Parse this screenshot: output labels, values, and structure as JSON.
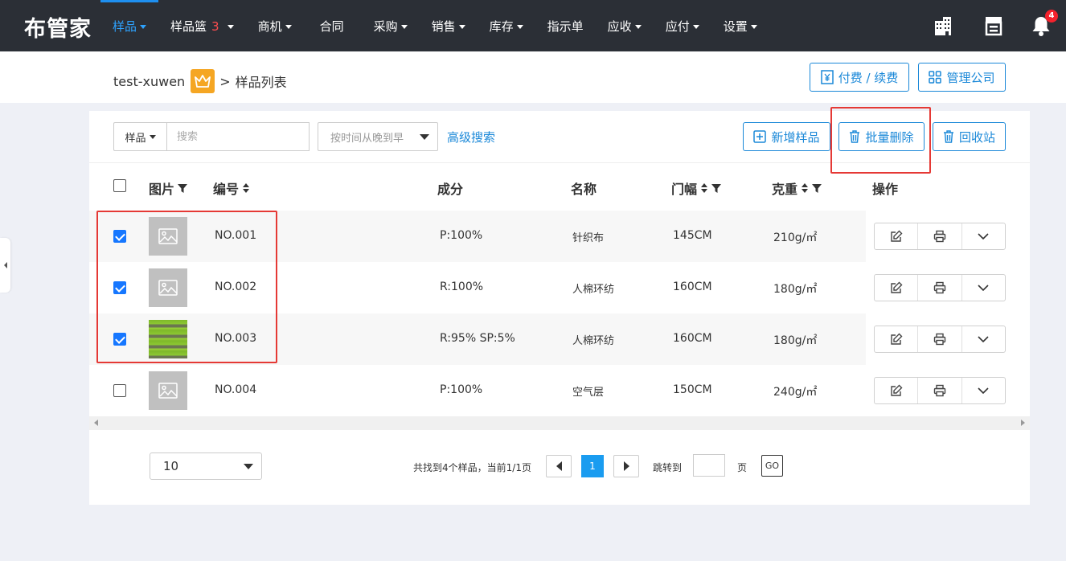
{
  "app": {
    "logo": "布管家"
  },
  "nav": [
    {
      "label": "样品",
      "caret": true,
      "active": true
    },
    {
      "label": "样品篮",
      "badge": "3",
      "caret": true
    },
    {
      "label": "商机",
      "caret": true
    },
    {
      "label": "合同",
      "caret": false
    },
    {
      "label": "采购",
      "caret": true
    },
    {
      "label": "销售",
      "caret": true
    },
    {
      "label": "库存",
      "caret": true
    },
    {
      "label": "指示单",
      "caret": false
    },
    {
      "label": "应收",
      "caret": true
    },
    {
      "label": "应付",
      "caret": true
    },
    {
      "label": "设置",
      "caret": true
    }
  ],
  "notifications": {
    "count": "4"
  },
  "breadcrumb": {
    "user": "test-xuwen",
    "separator": ">",
    "page": "样品列表"
  },
  "header_buttons": {
    "pay": "付费 / 续费",
    "company": "管理公司"
  },
  "filters": {
    "type_select": "样品",
    "search_placeholder": "搜索",
    "sort_select": "按时间从晚到早",
    "advanced": "高级搜索"
  },
  "actions": {
    "add": "新增样品",
    "batch_delete": "批量删除",
    "recycle": "回收站"
  },
  "table": {
    "columns": {
      "image": "图片",
      "code": "编号",
      "composition": "成分",
      "name": "名称",
      "width": "门幅",
      "weight": "克重",
      "ops": "操作"
    },
    "rows": [
      {
        "checked": true,
        "code": "NO.001",
        "composition": "P:100%",
        "name": "针织布",
        "width": "145CM",
        "weight": "210g/㎡",
        "image": "placeholder"
      },
      {
        "checked": true,
        "code": "NO.002",
        "composition": "R:100%",
        "name": "人棉环纺",
        "width": "160CM",
        "weight": "180g/㎡",
        "image": "placeholder"
      },
      {
        "checked": true,
        "code": "NO.003",
        "composition": "R:95% SP:5%",
        "name": "人棉环纺",
        "width": "160CM",
        "weight": "180g/㎡",
        "image": "fabric"
      },
      {
        "checked": false,
        "code": "NO.004",
        "composition": "P:100%",
        "name": "空气层",
        "width": "150CM",
        "weight": "240g/㎡",
        "image": "placeholder"
      }
    ]
  },
  "pagination": {
    "page_size": "10",
    "summary": "共找到4个样品，当前1/1页",
    "current_page": "1",
    "jump_label": "跳转到",
    "page_unit": "页",
    "go": "GO"
  },
  "colors": {
    "nav_bg": "#2b2f36",
    "accent": "#1a88d8",
    "highlight_red": "#e53935"
  }
}
